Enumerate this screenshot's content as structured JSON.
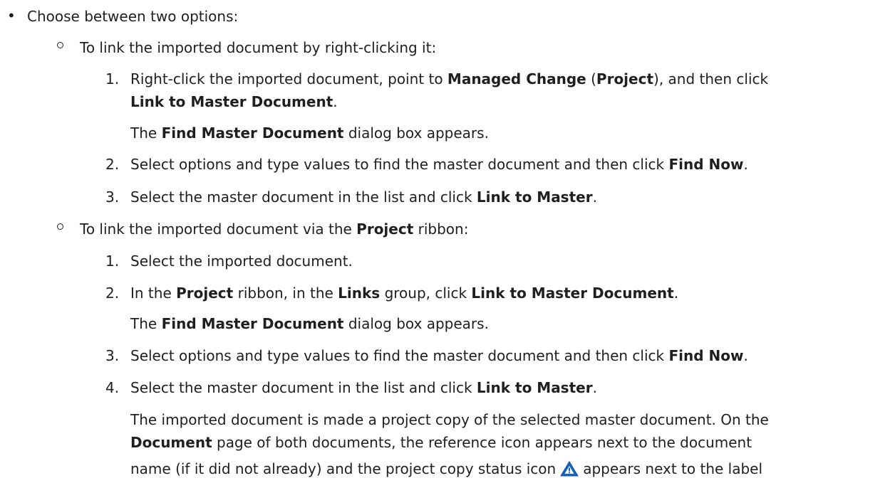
{
  "intro": "Choose between two options:",
  "option1": {
    "heading": "To link the imported document by right-clicking it:",
    "step1": {
      "num": "1.",
      "a": "Right-click the imported document, point to ",
      "b1": "Managed Change",
      "c": " (",
      "b2": "Project",
      "d": "), and then click",
      "b3": "Link to Master Document",
      "e": "."
    },
    "step1_result": {
      "a": "The ",
      "b": "Find Master Document",
      "c": " dialog box appears."
    },
    "step2": {
      "num": "2.",
      "a": "Select options and type values to find the master document and then click ",
      "b": "Find Now",
      "c": "."
    },
    "step3": {
      "num": "3.",
      "a": "Select the master document in the list and click ",
      "b": "Link to Master",
      "c": "."
    }
  },
  "option2": {
    "heading": {
      "a": "To link the imported document via the ",
      "b": "Project",
      "c": " ribbon:"
    },
    "step1": {
      "num": "1.",
      "a": "Select the imported document."
    },
    "step2": {
      "num": "2.",
      "a": "In the ",
      "b1": "Project",
      "c": " ribbon, in the ",
      "b2": "Links",
      "d": " group, click ",
      "b3": "Link to Master Document",
      "e": "."
    },
    "step2_result": {
      "a": "The ",
      "b": "Find Master Document",
      "c": " dialog box appears."
    },
    "step3": {
      "num": "3.",
      "a": "Select options and type values to find the master document and then click ",
      "b": "Find Now",
      "c": "."
    },
    "step4": {
      "num": "4.",
      "a": "Select the master document in the list and click ",
      "b": "Link to Master",
      "c": "."
    },
    "result": {
      "line1": "The imported document is made a project copy of the selected master document. On the",
      "b": "Document",
      "line2": " page of both documents, the reference icon appears next to the document",
      "line3a": "name (if it did not already) and the project copy status icon",
      "line3b": "appears next to the label"
    }
  },
  "icons": {
    "bullet": "bullet-disc",
    "sub_bullet": "bullet-circle",
    "project_copy_status": "project-copy-status-icon"
  },
  "colors": {
    "icon_blue": "#1565c0",
    "text": "#1f1f1f"
  }
}
